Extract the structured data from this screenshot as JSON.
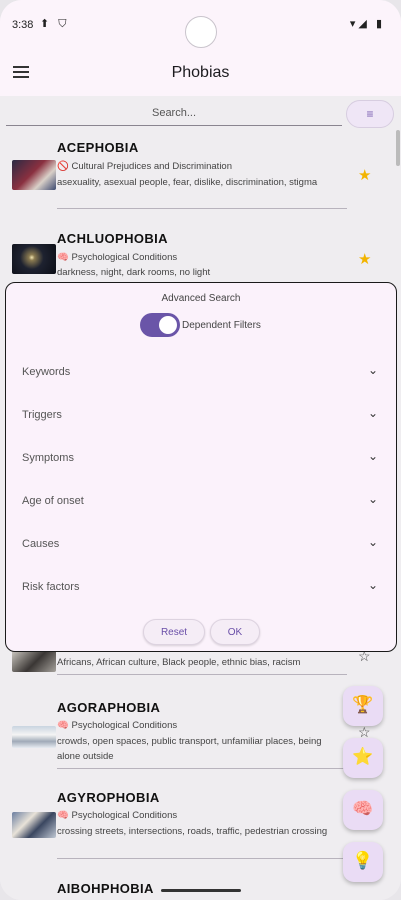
{
  "status_bar": {
    "time": "3:38",
    "left_icons": "⬆ ⛉",
    "right_icons": "▾◢ ▮"
  },
  "app_bar": {
    "title": "Phobias"
  },
  "search": {
    "placeholder": "Search...",
    "filter_icon": "≡"
  },
  "phobias": [
    {
      "name": "ACEPHOBIA",
      "category_emoji": "🚫",
      "category": "Cultural Prejudices and Discrimination",
      "keywords": "asexuality, asexual people, fear, dislike, discrimination, stigma",
      "favorite": true,
      "star": "★"
    },
    {
      "name": "ACHLUOPHOBIA",
      "category_emoji": "🧠",
      "category": "Psychological Conditions",
      "keywords": "darkness, night, dark rooms, no light",
      "favorite": true,
      "star": "★"
    },
    {
      "name": "",
      "category_emoji": "",
      "category": "",
      "keywords": "Africans, African culture, Black people, ethnic bias, racism",
      "favorite": false,
      "star": "☆"
    },
    {
      "name": "AGORAPHOBIA",
      "category_emoji": "🧠",
      "category": "Psychological Conditions",
      "keywords": "crowds, open spaces, public transport, unfamiliar places, being alone outside",
      "favorite": false,
      "star": "☆"
    },
    {
      "name": "AGYROPHOBIA",
      "category_emoji": "🧠",
      "category": "Psychological Conditions",
      "keywords": "crossing streets, intersections, roads, traffic, pedestrian crossing",
      "favorite": false,
      "star": "☆"
    },
    {
      "name": "AIBOHPHOBIA",
      "category_emoji": "",
      "category": "",
      "keywords": "",
      "favorite": false,
      "star": ""
    }
  ],
  "advanced_search": {
    "title": "Advanced Search",
    "dependent_filters_label": "Dependent Filters",
    "dependent_filters_on": true,
    "filters": [
      "Keywords",
      "Triggers",
      "Symptoms",
      "Age of onset",
      "Causes",
      "Risk factors"
    ],
    "chevron": "⌄",
    "reset_label": "Reset",
    "ok_label": "OK"
  },
  "fabs": [
    {
      "icon": "🏆",
      "name": "trophy-icon"
    },
    {
      "icon": "⭐",
      "name": "star-icon"
    },
    {
      "icon": "🧠",
      "name": "brain-icon"
    },
    {
      "icon": "💡",
      "name": "lightbulb-icon"
    }
  ],
  "colors": {
    "accent": "#6a55a8",
    "star": "#f2b400",
    "fab_bg": "#eadcf5"
  }
}
